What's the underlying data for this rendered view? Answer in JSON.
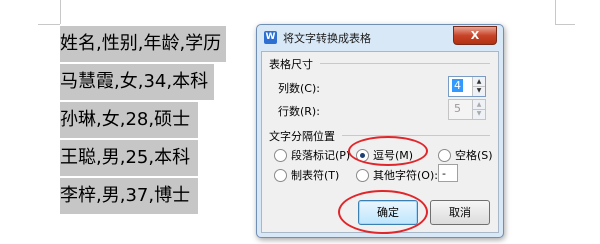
{
  "document": {
    "lines": [
      "姓名,性别,年龄,学历",
      "马慧霞,女,34,本科",
      "孙琳,女,28,硕士",
      "王聪,男,25,本科",
      "李梓,男,37,博士"
    ]
  },
  "dialog": {
    "title": "将文字转换成表格",
    "close_label": "X",
    "table_size": {
      "group_title": "表格尺寸",
      "columns_label": "列数(C):",
      "columns_value": "4",
      "rows_label": "行数(R):",
      "rows_value": "5"
    },
    "separator": {
      "group_title": "文字分隔位置",
      "options": [
        {
          "label": "段落标记(P)",
          "selected": false
        },
        {
          "label": "逗号(M)",
          "selected": true
        },
        {
          "label": "空格(S)",
          "selected": false
        },
        {
          "label": "制表符(T)",
          "selected": false
        },
        {
          "label": "其他字符(O):",
          "selected": false
        }
      ],
      "other_value": "-"
    },
    "ok_label": "确定",
    "cancel_label": "取消"
  },
  "colors": {
    "selection": "#c6c6c6",
    "annotation": "#e0262a",
    "dialog_frame": "#d9e8f7"
  }
}
